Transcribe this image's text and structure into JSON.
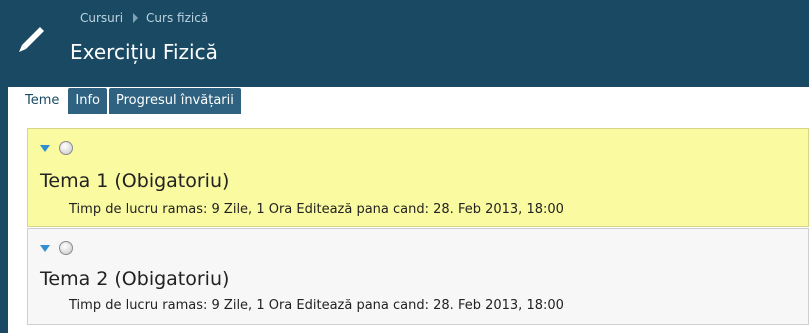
{
  "breadcrumb": [
    "Cursuri",
    "Curs fizică"
  ],
  "title": "Exercițiu Fizică",
  "tabs": [
    {
      "label": "Teme",
      "active": true
    },
    {
      "label": "Info",
      "active": false
    },
    {
      "label": "Progresul învățarii",
      "active": false
    }
  ],
  "topics": [
    {
      "title": "Tema 1 (Obigatoriu)",
      "meta": "Timp de lucru ramas: 9 Zile, 1 Ora  Editează pana cand: 28. Feb 2013, 18:00",
      "highlighted": true
    },
    {
      "title": "Tema 2 (Obigatoriu)",
      "meta": "Timp de lucru ramas: 9 Zile, 1 Ora  Editează pana cand: 28. Feb 2013, 18:00",
      "highlighted": false
    }
  ],
  "colors": {
    "header": "#1a4a63",
    "highlight": "#fafaa0",
    "accent": "#2f8fd0"
  },
  "icons": {
    "app": "pencil-icon",
    "expand": "triangle-down-icon",
    "status": "status-circle-icon"
  }
}
